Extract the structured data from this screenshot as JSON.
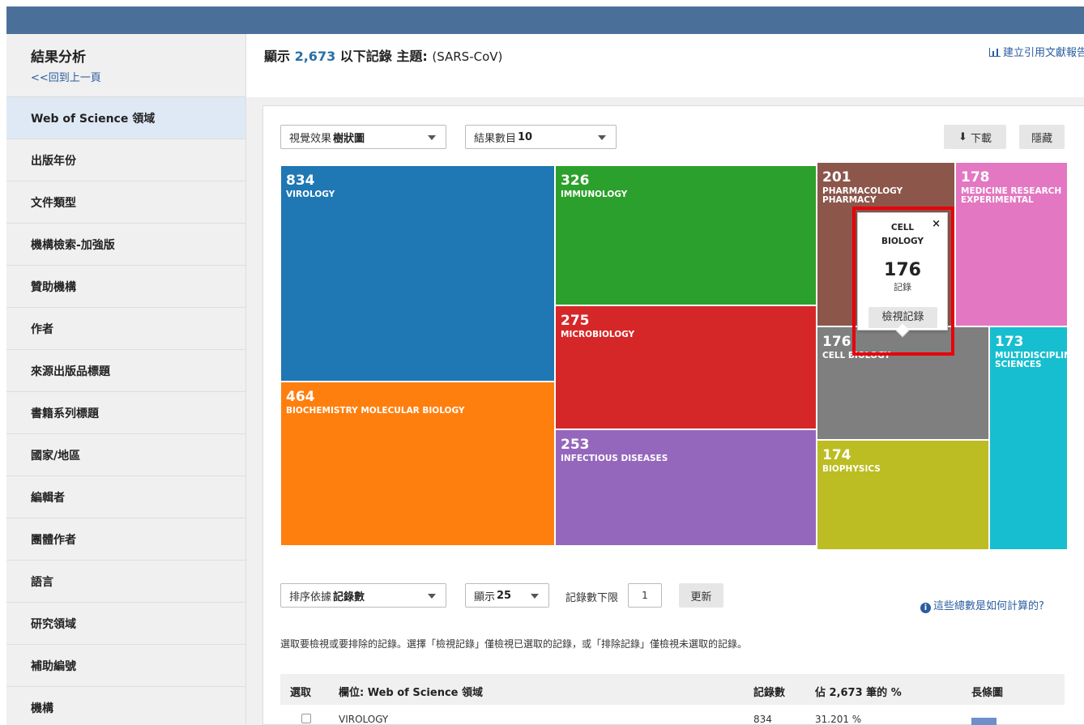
{
  "sidebar": {
    "title": "結果分析",
    "back": "<<回到上一頁",
    "items": [
      {
        "label": "Web of Science 領域",
        "active": true
      },
      {
        "label": "出版年份"
      },
      {
        "label": "文件類型"
      },
      {
        "label": "機構檢索-加強版"
      },
      {
        "label": "贊助機構"
      },
      {
        "label": "作者"
      },
      {
        "label": "來源出版品標題"
      },
      {
        "label": "書籍系列標題"
      },
      {
        "label": "國家/地區"
      },
      {
        "label": "編輯者"
      },
      {
        "label": "團體作者"
      },
      {
        "label": "語言"
      },
      {
        "label": "研究領域"
      },
      {
        "label": "補助編號"
      },
      {
        "label": "機構"
      }
    ]
  },
  "header": {
    "prefix": "顯示",
    "count": "2,673",
    "middle": "以下記錄 主題:",
    "topic": "(SARS-CoV)",
    "citation_link": "建立引用文獻報告"
  },
  "controls": {
    "viz_label": "視覺效果",
    "viz_value": "樹狀圖",
    "results_label": "結果數目",
    "results_value": "10",
    "download": "下載",
    "hide": "隱藏"
  },
  "chart_data": {
    "type": "treemap",
    "items": [
      {
        "label": "VIROLOGY",
        "value": 834,
        "color": "#1f77b4"
      },
      {
        "label": "BIOCHEMISTRY MOLECULAR BIOLOGY",
        "value": 464,
        "color": "#ff7f0e"
      },
      {
        "label": "IMMUNOLOGY",
        "value": 326,
        "color": "#2ca02c"
      },
      {
        "label": "MICROBIOLOGY",
        "value": 275,
        "color": "#d62728"
      },
      {
        "label": "INFECTIOUS DISEASES",
        "value": 253,
        "color": "#9467bd"
      },
      {
        "label": "PHARMACOLOGY PHARMACY",
        "value": 201,
        "color": "#8c564b"
      },
      {
        "label": "MEDICINE RESEARCH EXPERIMENTAL",
        "value": 178,
        "color": "#e377c2"
      },
      {
        "label": "CELL BIOLOGY",
        "value": 176,
        "color": "#7f7f7f"
      },
      {
        "label": "BIOPHYSICS",
        "value": 174,
        "color": "#bcbd22"
      },
      {
        "label": "MULTIDISCIPLINARY SCIENCES",
        "value": 173,
        "color": "#17becf"
      }
    ]
  },
  "tooltip": {
    "title_line1": "CELL",
    "title_line2": "BIOLOGY",
    "count": "176",
    "unit": "記錄",
    "view_button": "檢視記錄",
    "close": "×"
  },
  "table_controls": {
    "sort_label": "排序依據",
    "sort_value": "記錄數",
    "show_label": "顯示",
    "show_value": "25",
    "min_label": "記錄數下限",
    "min_value": "1",
    "update": "更新",
    "help": "這些總數是如何計算的?"
  },
  "instructions": "選取要檢視或要排除的記錄。選擇「檢視記錄」僅檢視已選取的記錄，或「排除記錄」僅檢視未選取的記錄。",
  "table": {
    "headers": {
      "select": "選取",
      "field": "欄位: Web of Science 領域",
      "count": "記錄數",
      "pct": "佔 2,673 筆的 %",
      "bar": "長條圖"
    },
    "rows": [
      {
        "field": "VIROLOGY",
        "count": "834",
        "pct": "31.201 %",
        "fraction": 0.312
      }
    ]
  }
}
